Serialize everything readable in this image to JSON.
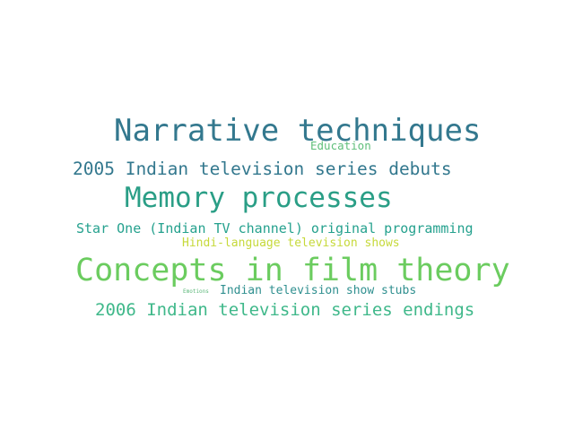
{
  "words": [
    {
      "id": "w-narrative",
      "text": "Narrative techniques",
      "color": "#33788e"
    },
    {
      "id": "w-education",
      "text": "Education",
      "color": "#5fbf7a"
    },
    {
      "id": "w-2005",
      "text": "2005 Indian television series debuts",
      "color": "#33788e"
    },
    {
      "id": "w-memory",
      "text": "Memory processes",
      "color": "#2a9e86"
    },
    {
      "id": "w-starone",
      "text": "Star One (Indian TV channel) original programming",
      "color": "#25a18e"
    },
    {
      "id": "w-hindi",
      "text": "Hindi-language television shows",
      "color": "#c6d93a"
    },
    {
      "id": "w-concepts",
      "text": "Concepts in film theory",
      "color": "#6bcc5f"
    },
    {
      "id": "w-emotions",
      "text": "Emotions",
      "color": "#5cb87a"
    },
    {
      "id": "w-stubs",
      "text": "Indian television show stubs",
      "color": "#2f8f8f"
    },
    {
      "id": "w-2006",
      "text": "2006 Indian television series endings",
      "color": "#3fb88a"
    }
  ]
}
